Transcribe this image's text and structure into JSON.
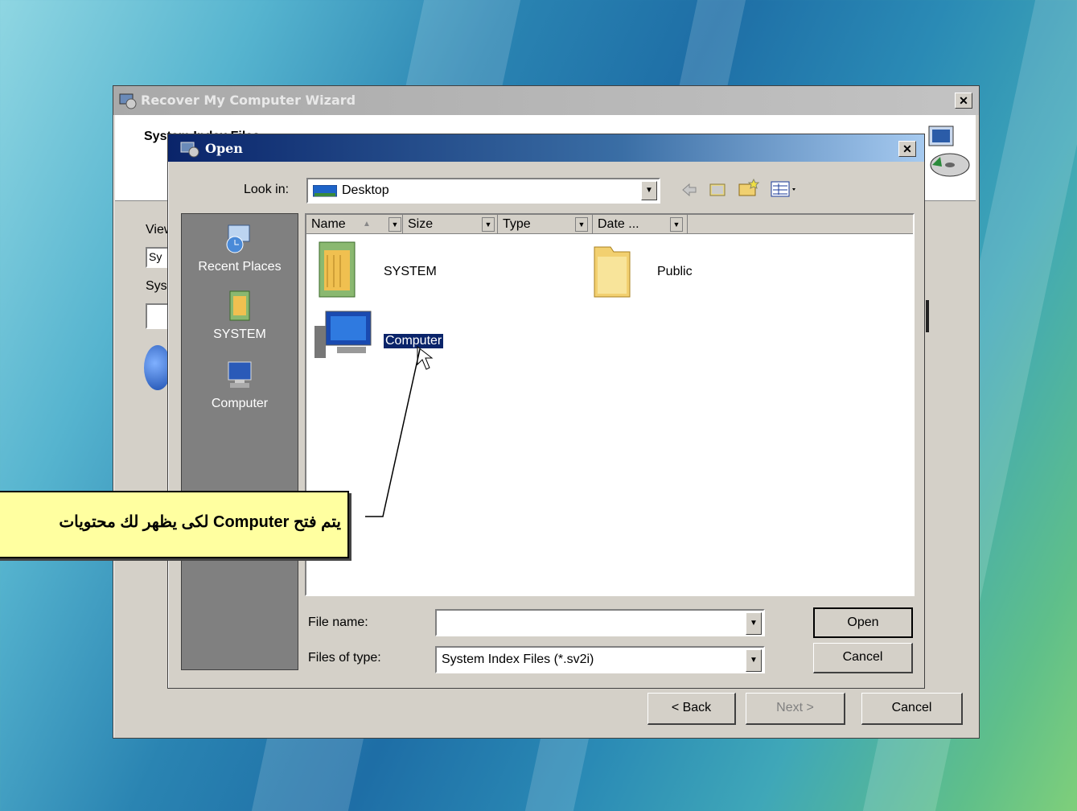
{
  "wizard": {
    "title": "Recover My Computer Wizard",
    "close_glyph": "✕",
    "header_heading": "System Index Files",
    "field_label_1": "View",
    "field_value_1": "Sy",
    "field_label_2": "Sys",
    "buttons": {
      "back": "< Back",
      "next": "Next >",
      "cancel": "Cancel"
    }
  },
  "dialog": {
    "title": "Open",
    "close_glyph": "✕",
    "look_in_label": "Look in:",
    "look_in_value": "Desktop",
    "toolbar_icons": [
      "back-arrow-icon",
      "up-folder-icon",
      "new-folder-icon",
      "view-menu-icon"
    ],
    "places": [
      {
        "label": "Recent Places",
        "icon": "recent-places-icon"
      },
      {
        "label": "SYSTEM",
        "icon": "user-folder-icon"
      },
      {
        "label": "Computer",
        "icon": "computer-icon"
      }
    ],
    "columns": [
      "Name",
      "Size",
      "Type",
      "Date ..."
    ],
    "items": [
      {
        "label": "SYSTEM",
        "icon": "user-folder-icon"
      },
      {
        "label": "Public",
        "icon": "folder-icon"
      },
      {
        "label": "Computer",
        "icon": "computer-icon",
        "selected": true
      }
    ],
    "file_name_label": "File name:",
    "file_name_value": "",
    "files_of_type_label": "Files of type:",
    "files_of_type_value": "System Index Files (*.sv2i)",
    "open_button": "Open",
    "cancel_button": "Cancel"
  },
  "callout": {
    "text": "يتم فتح  Computer لكى يظهر لك محتويات"
  },
  "colors": {
    "title_active": "#0a246a",
    "selection": "#0a246a",
    "callout_bg": "#ffffa0"
  }
}
